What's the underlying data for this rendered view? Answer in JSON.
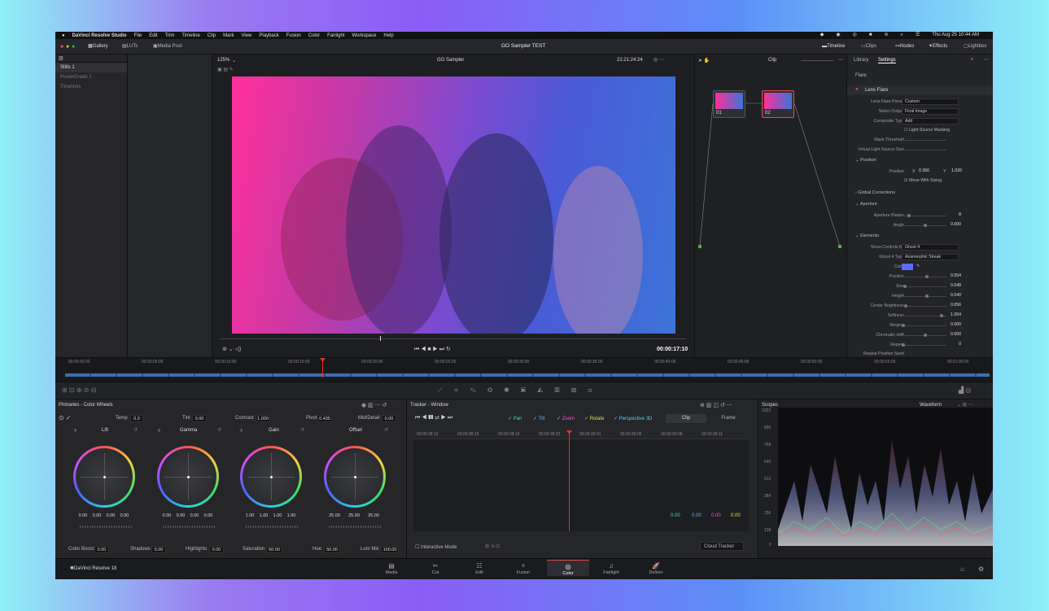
{
  "menubar": {
    "app_name": "DaVinci Resolve Studio",
    "items": [
      "File",
      "Edit",
      "Trim",
      "Timeline",
      "Clip",
      "Mark",
      "View",
      "Playback",
      "Fusion",
      "Color",
      "Fairlight",
      "Workspace",
      "Help"
    ],
    "datetime": "Thu Aug 25  10:44 AM"
  },
  "toolbar": {
    "gallery": "Gallery",
    "luts": "LUTs",
    "media_pool": "Media Pool",
    "project_title": "GO Sampler TEST",
    "timeline": "Timeline",
    "clips": "Clips",
    "nodes": "Nodes",
    "effects": "Effects",
    "lightbox": "Lightbox"
  },
  "gallery": {
    "items": [
      "Stills 1",
      "PowerGrade 1",
      "Timelines"
    ]
  },
  "viewer": {
    "zoom": "125%",
    "clip_name": "GO Sampler",
    "timecode_top": "21:21:24:24",
    "clip_mode": "Clip",
    "timecode": "00:00:17:10"
  },
  "nodes": {
    "node1_label": "01",
    "node2_label": "02"
  },
  "settings": {
    "tab_library": "Library",
    "tab_settings": "Settings",
    "search": "Flare",
    "effect_name": "Lens Flare",
    "rows": [
      {
        "label": "Lens Flare Preset",
        "value": "Custom"
      },
      {
        "label": "Select Output",
        "value": "Final Image"
      },
      {
        "label": "Composite Type",
        "value": "Add"
      }
    ],
    "light_source_masking": "Light Source Masking",
    "mask_threshold": "Mask Threshold",
    "virtual_light": "Virtual Light Source Size",
    "position_section": "Position",
    "position_label": "Position",
    "pos_x_label": "X",
    "pos_x": "0.366",
    "pos_y_label": "Y",
    "pos_y": "1.026",
    "move_with_sizing": "Move With Sizing",
    "global_corrections": "Global Corrections",
    "aperture_section": "Aperture",
    "aperture_blades": "Aperture Blades",
    "aperture_blades_val": "8",
    "angle": "Angle",
    "angle_val": "0.000",
    "elements_section": "Elements",
    "show_controls_for": "Show Controls for",
    "show_controls_val": "Ghost 4",
    "ghost_type": "Ghost 4 Type",
    "ghost_type_val": "Anamorphic Streak",
    "color_label": "Color",
    "element_rows": [
      {
        "label": "Position",
        "value": "0.554"
      },
      {
        "label": "Size",
        "value": "0.048"
      },
      {
        "label": "Height",
        "value": "0.540"
      },
      {
        "label": "Center Brightness",
        "value": "0.056"
      },
      {
        "label": "Softness",
        "value": "1.054"
      },
      {
        "label": "Ringing",
        "value": "0.000"
      },
      {
        "label": "Chromatic shift",
        "value": "0.000"
      },
      {
        "label": "Repeat",
        "value": "0"
      },
      {
        "label": "Repeat Position Seed",
        "value": ""
      }
    ]
  },
  "timeline_ruler": [
    "00:00:00:00",
    "00:00:05:00",
    "00:00:10:00",
    "00:00:15:00",
    "00:00:20:00",
    "00:00:25:00",
    "00:00:30:00",
    "00:00:35:00",
    "00:00:40:00",
    "00:00:45:00",
    "00:00:50:00",
    "00:00:55:00",
    "00:01:00:00"
  ],
  "primaries": {
    "title": "Primaries - Color Wheels",
    "temp_label": "Temp",
    "temp": "0.0",
    "tint_label": "Tint",
    "tint": "0.00",
    "contrast_label": "Contrast",
    "contrast": "1.000",
    "pivot_label": "Pivot",
    "pivot": "0.435",
    "middetail_label": "Mid/Detail",
    "middetail": "0.00",
    "wheels": [
      {
        "name": "Lift",
        "values": [
          "0.00",
          "0.00",
          "0.00",
          "0.00"
        ]
      },
      {
        "name": "Gamma",
        "values": [
          "0.00",
          "0.00",
          "0.00",
          "0.00"
        ]
      },
      {
        "name": "Gain",
        "values": [
          "1.00",
          "1.00",
          "1.00",
          "1.00"
        ]
      },
      {
        "name": "Offset",
        "values": [
          "25.00",
          "25.00",
          "25.00"
        ]
      }
    ],
    "colorboost_label": "Color Boost",
    "colorboost": "0.00",
    "shadows_label": "Shadows",
    "shadows": "0.00",
    "highlights_label": "Highlights",
    "highlights": "0.00",
    "saturation_label": "Saturation",
    "saturation": "50.00",
    "hue_label": "Hue",
    "hue": "50.00",
    "lummix_label": "Lum Mix",
    "lummix": "100.00"
  },
  "tracker": {
    "title": "Tracker - Window",
    "checks": [
      {
        "label": "Pan",
        "color": "#3fe0a0"
      },
      {
        "label": "Tilt",
        "color": "#5fb0ff"
      },
      {
        "label": "Zoom",
        "color": "#ff4fd8"
      },
      {
        "label": "Rotate",
        "color": "#e0e04f"
      },
      {
        "label": "Perspective 3D",
        "color": "#4fd0ff"
      }
    ],
    "clip_btn": "Clip",
    "frame_btn": "Frame",
    "ruler": [
      "00:00:38:12",
      "00:00:38:15",
      "00:00:38:19",
      "00:00:38:22",
      "00:00:39:01",
      "00:00:39:05",
      "00:00:39:08",
      "00:00:39:11"
    ],
    "readouts": [
      {
        "value": "0.00",
        "color": "#3fe0a0"
      },
      {
        "value": "0.00",
        "color": "#5fb0ff"
      },
      {
        "value": "0.00",
        "color": "#ff4fd8"
      },
      {
        "value": "0.00",
        "color": "#e0e04f"
      }
    ],
    "interactive_mode": "Interactive Mode",
    "cloud_tracker": "Cloud Tracker"
  },
  "scopes": {
    "title": "Scopes",
    "mode": "Waveform",
    "scale": [
      "1023",
      "896",
      "768",
      "640",
      "512",
      "384",
      "256",
      "128",
      "0"
    ]
  },
  "footer": {
    "brand": "DaVinci Resolve 18",
    "pages": [
      "Media",
      "Cut",
      "Edit",
      "Fusion",
      "Color",
      "Fairlight",
      "Deliver"
    ],
    "active_page": "Color"
  },
  "colors": {
    "accent": "#e84a4a",
    "active_tab": "#ffffff",
    "playhead": "#e03030",
    "swatch": "#5a6bff"
  }
}
